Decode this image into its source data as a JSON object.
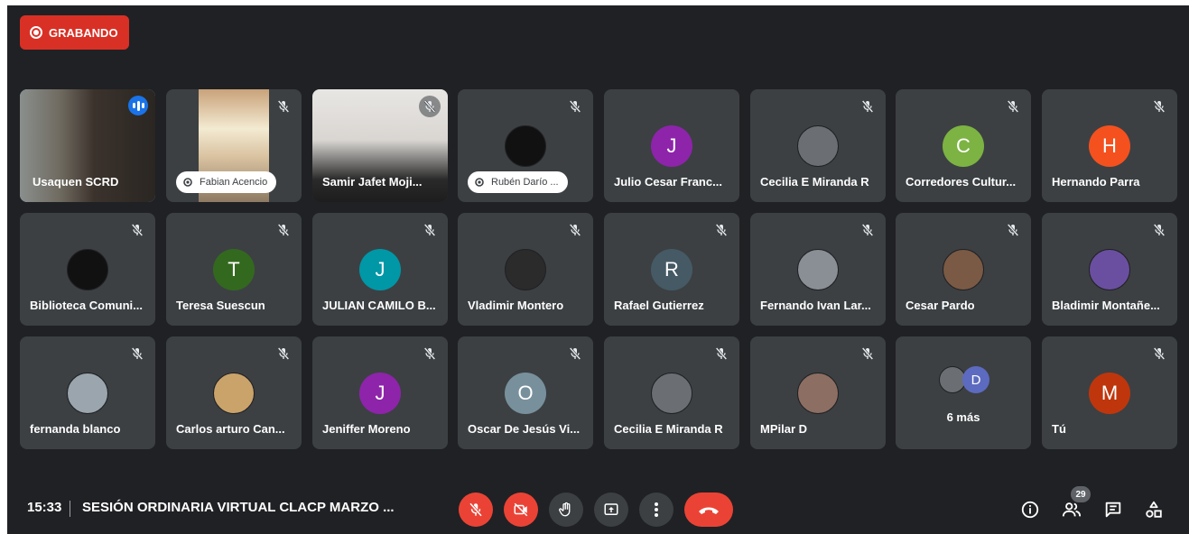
{
  "recording": {
    "label": "GRABANDO",
    "color": "#d93025"
  },
  "tiles": [
    {
      "name": "Usaquen SCRD",
      "kind": "video",
      "speaking": true
    },
    {
      "name": "Fabian Acencio",
      "kind": "video-pill",
      "muted": true
    },
    {
      "name": "Samir Jafet Moji...",
      "kind": "video",
      "muted": true
    },
    {
      "name": "Rubén Darío ...",
      "kind": "avatar-pill",
      "avatar": "image",
      "avatar_color": "#111111",
      "muted": true
    },
    {
      "name": "Julio Cesar Franc...",
      "initial": "J",
      "avatar_color": "#8e24aa",
      "muted": false
    },
    {
      "name": "Cecilia E Miranda R",
      "avatar": "image",
      "avatar_color": "#6b6f73",
      "muted": true
    },
    {
      "name": "Corredores Cultur...",
      "initial": "C",
      "avatar_color": "#7cb342",
      "muted": true
    },
    {
      "name": "Hernando Parra",
      "initial": "H",
      "avatar_color": "#f4511e",
      "muted": true
    },
    {
      "name": "Biblioteca Comuni...",
      "avatar": "image",
      "avatar_color": "#111111",
      "muted": true
    },
    {
      "name": "Teresa Suescun",
      "initial": "T",
      "avatar_color": "#33691e",
      "muted": true
    },
    {
      "name": "JULIAN CAMILO B...",
      "initial": "J",
      "avatar_color": "#0097a7",
      "muted": true
    },
    {
      "name": "Vladimir Montero",
      "avatar": "image",
      "avatar_color": "#2b2b2b",
      "muted": true
    },
    {
      "name": "Rafael Gutierrez",
      "initial": "R",
      "avatar_color": "#455a64",
      "muted": true
    },
    {
      "name": "Fernando Ivan Lar...",
      "avatar": "image",
      "avatar_color": "#8a8f96",
      "muted": true
    },
    {
      "name": "Cesar Pardo",
      "avatar": "image",
      "avatar_color": "#7a5a45",
      "muted": true
    },
    {
      "name": "Bladimir Montañe...",
      "avatar": "image",
      "avatar_color": "#6a4fa0",
      "muted": true
    },
    {
      "name": "fernanda blanco",
      "avatar": "image",
      "avatar_color": "#9aa5ad",
      "muted": true
    },
    {
      "name": "Carlos arturo Can...",
      "avatar": "image",
      "avatar_color": "#c9a36a",
      "muted": true
    },
    {
      "name": "Jeniffer Moreno",
      "initial": "J",
      "avatar_color": "#8e24aa",
      "muted": true
    },
    {
      "name": "Oscar De Jesús Vi...",
      "initial": "O",
      "avatar_color": "#78909c",
      "muted": true
    },
    {
      "name": "Cecilia E Miranda R",
      "avatar": "image",
      "avatar_color": "#6b6f73",
      "muted": true
    },
    {
      "name": "MPilar D",
      "avatar": "image",
      "avatar_color": "#8d6e63",
      "muted": true
    },
    {
      "name": "6 más",
      "kind": "more",
      "initial": "D",
      "avatar_color": "#5c6bc0",
      "muted": false
    },
    {
      "name": "Tú",
      "initial": "M",
      "avatar_color": "#bf360c",
      "muted": true
    }
  ],
  "bottom_bar": {
    "time": "15:33",
    "meeting_title": "SESIÓN ORDINARIA VIRTUAL CLACP MARZO ...",
    "participants_count": "29",
    "controls": [
      "mic-off",
      "camera-off",
      "raise-hand",
      "present",
      "more-options",
      "leave-call"
    ],
    "right_icons": [
      "info",
      "people",
      "chat",
      "activities"
    ]
  }
}
